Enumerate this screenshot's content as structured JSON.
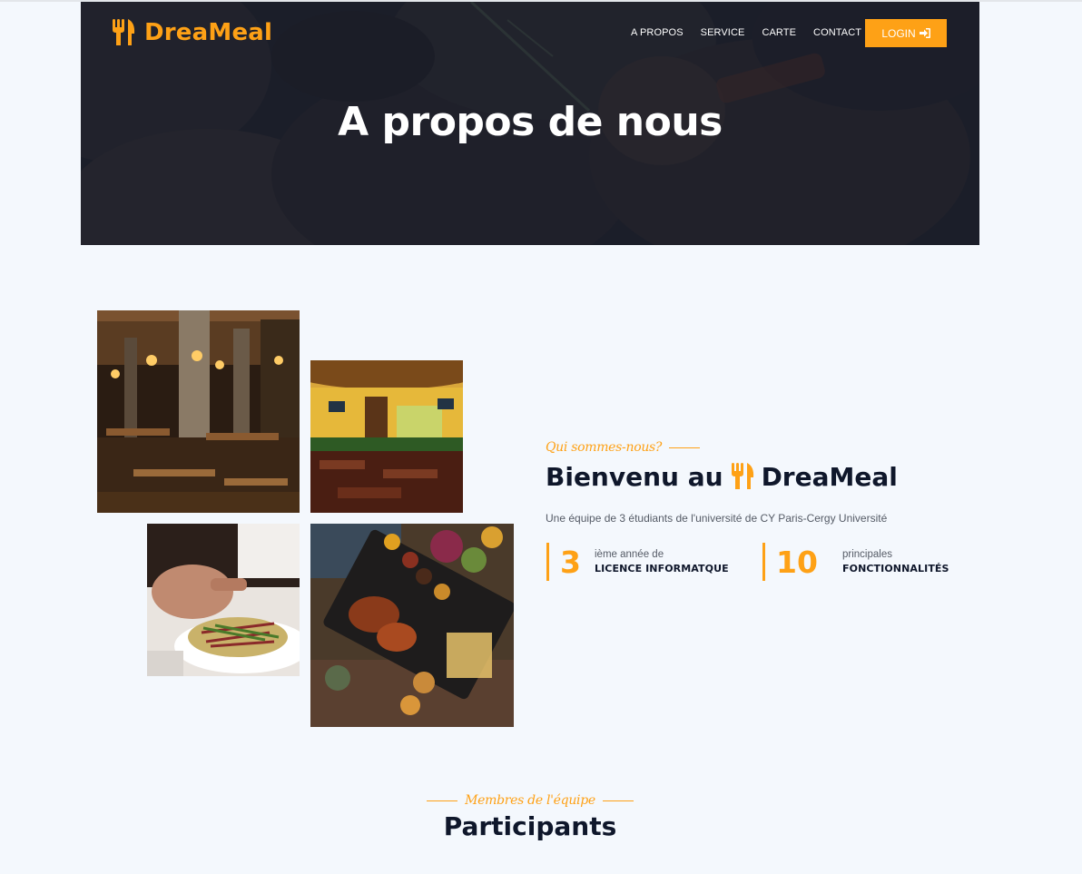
{
  "brand": {
    "name": "DreaMeal",
    "icon": "utensils-icon",
    "accent": "#fea116",
    "dark": "#0f172b"
  },
  "nav": {
    "items": [
      {
        "label": "A PROPOS"
      },
      {
        "label": "SERVICE"
      },
      {
        "label": "CARTE"
      },
      {
        "label": "CONTACT"
      }
    ],
    "login_label": "LOGIN",
    "login_icon": "sign-in-icon"
  },
  "hero": {
    "title": "A propos de nous"
  },
  "about": {
    "kicker": "Qui sommes-nous?",
    "title_prefix": "Bienvenu au",
    "title_brand": "DreaMeal",
    "description": "Une équipe de 3 étudiants de l'université de CY Paris-Cergy Université",
    "stats": [
      {
        "number": "3",
        "small": "ième année de",
        "big": "LICENCE INFORMATQUE"
      },
      {
        "number": "10",
        "small": "principales",
        "big": "FONCTIONNALITÉS"
      }
    ]
  },
  "gallery": [
    {
      "alt": "restaurant-interior-dark"
    },
    {
      "alt": "restaurant-interior-yellow"
    },
    {
      "alt": "salad-plate"
    },
    {
      "alt": "grilled-platter"
    }
  ],
  "team": {
    "kicker": "Membres de l'équipe",
    "title": "Participants"
  }
}
